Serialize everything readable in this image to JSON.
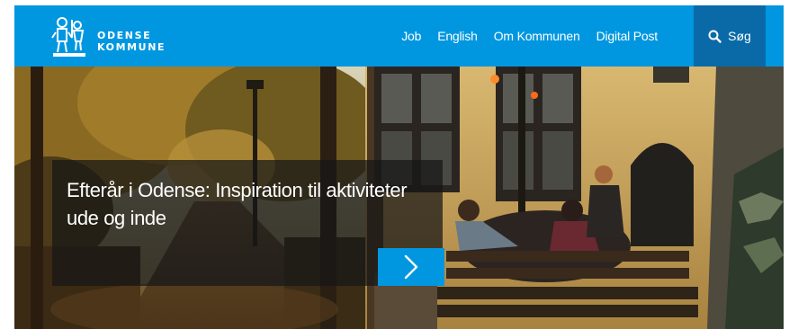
{
  "brand": {
    "line1": "ODENSE",
    "line2": "KOMMUNE",
    "color": "#0097e0"
  },
  "nav": {
    "items": [
      {
        "label": "Job"
      },
      {
        "label": "English"
      },
      {
        "label": "Om Kommunen"
      },
      {
        "label": "Digital Post"
      }
    ],
    "search_label": "Søg"
  },
  "hero": {
    "title": "Efterår i Odense: Inspiration til aktiviteter ude og inde",
    "next_icon": "chevron-right-icon"
  }
}
